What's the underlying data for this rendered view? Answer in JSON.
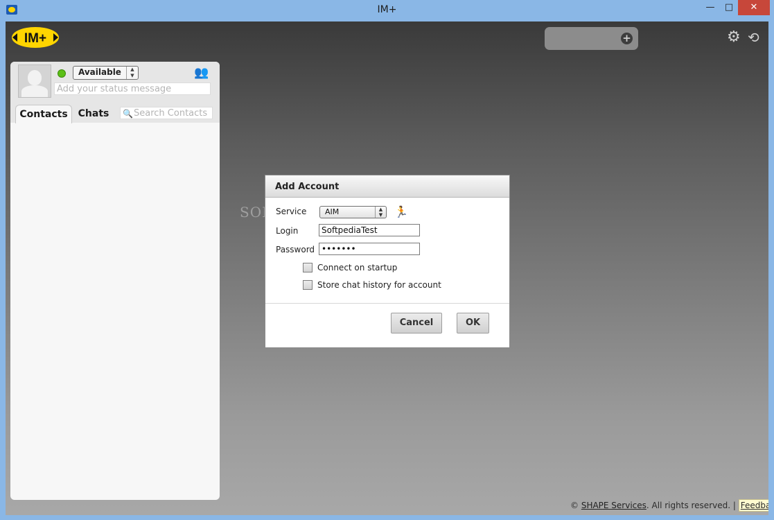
{
  "window": {
    "title": "IM+",
    "minimize": "—",
    "maximize": "□",
    "close": "✕"
  },
  "colors": {
    "accent_status": "#5bbf16",
    "logo_yellow": "#ffd500",
    "close_red": "#c7473a"
  },
  "header": {
    "logo_text": "IM+",
    "add_icon": "plus-icon",
    "settings_icon": "gear-icon",
    "signout_icon": "signout-icon"
  },
  "left_panel": {
    "status": "Available",
    "status_message_placeholder": "Add your status message",
    "tabs": [
      {
        "label": "Contacts"
      },
      {
        "label": "Chats"
      }
    ],
    "search_placeholder": "Search Contacts"
  },
  "dialog": {
    "title": "Add Account",
    "service_label": "Service",
    "service_value": "AIM",
    "login_label": "Login",
    "login_value": "SoftpediaTest",
    "password_label": "Password",
    "password_value": "•••••••",
    "checkboxes": [
      {
        "label": "Connect on startup",
        "checked": false
      },
      {
        "label": "Store chat history for account",
        "checked": false
      }
    ],
    "cancel": "Cancel",
    "ok": "OK"
  },
  "watermark": "SOFTPEDIA",
  "footer": {
    "copyright": "© ",
    "company": "SHAPE Services",
    "rights": ". All rights reserved. | ",
    "feedback": "Feedback"
  }
}
